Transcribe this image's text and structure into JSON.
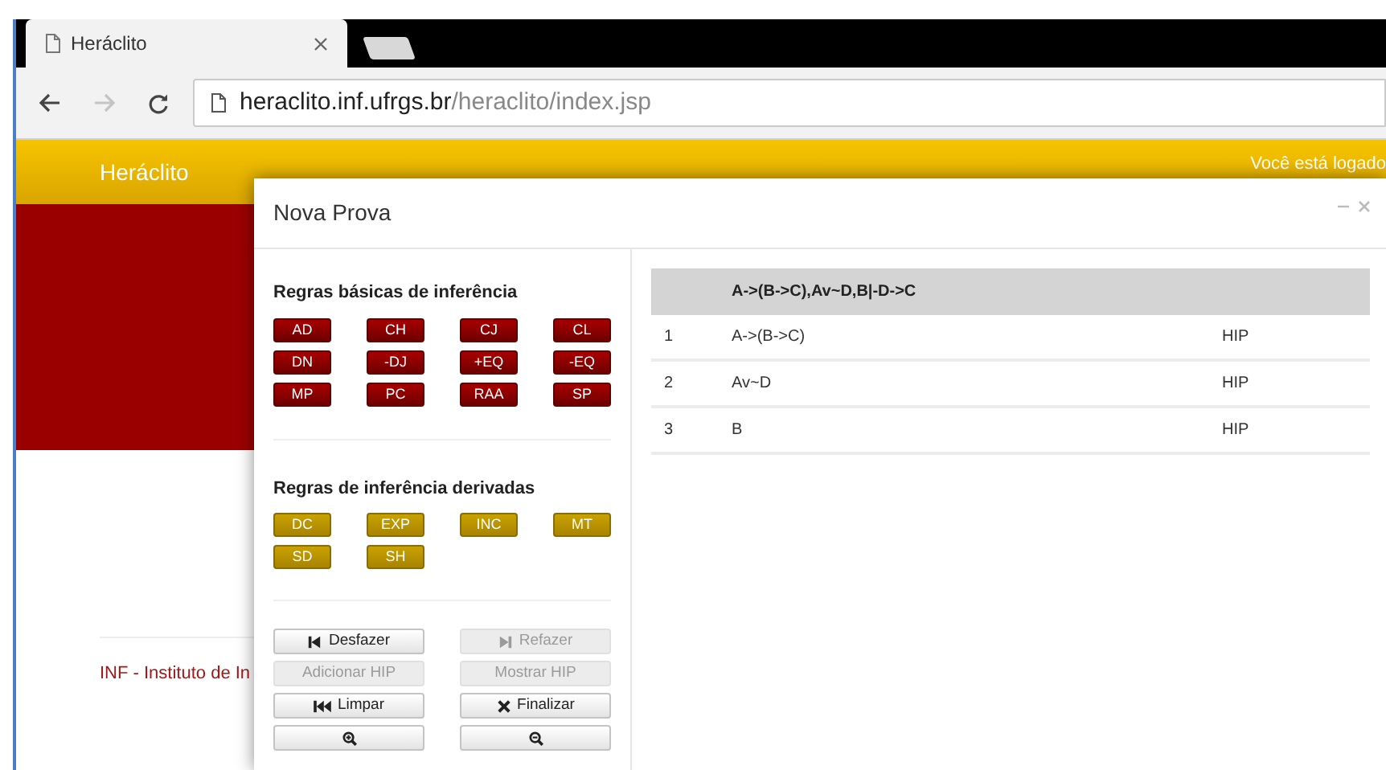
{
  "browser": {
    "tab": {
      "title": "Heráclito",
      "selected": true
    },
    "back_disabled": false,
    "forward_disabled": true,
    "url": {
      "host": "heraclito.inf.ufrgs.br",
      "path": "/heraclito/index.jsp"
    }
  },
  "page": {
    "brand": "Heráclito",
    "login_text": "Você está logado",
    "footer": "INF - Instituto de In"
  },
  "dialog": {
    "title": "Nova Prova",
    "basic_rules": {
      "heading": "Regras básicas de inferência",
      "items": [
        "AD",
        "CH",
        "CJ",
        "CL",
        "DN",
        "-DJ",
        "+EQ",
        "-EQ",
        "MP",
        "PC",
        "RAA",
        "SP"
      ]
    },
    "derived_rules": {
      "heading": "Regras de inferência derivadas",
      "items": [
        "DC",
        "EXP",
        "INC",
        "MT",
        "SD",
        "SH"
      ]
    },
    "actions": [
      {
        "kind": "undo",
        "label": "Desfazer",
        "disabled": false
      },
      {
        "kind": "redo",
        "label": "Refazer",
        "disabled": true
      },
      {
        "kind": "plain",
        "label": "Adicionar HIP",
        "disabled": true
      },
      {
        "kind": "plain",
        "label": "Mostrar HIP",
        "disabled": true
      },
      {
        "kind": "clear",
        "label": "Limpar",
        "disabled": false
      },
      {
        "kind": "finish",
        "label": "Finalizar",
        "disabled": false
      },
      {
        "kind": "zoom-in",
        "disabled": false
      },
      {
        "kind": "zoom-out",
        "disabled": false
      }
    ],
    "proof": {
      "header": "A->(B->C),Av~D,B|-D->C",
      "rows": [
        {
          "column_1": "1",
          "formula": "A->(B->C)",
          "column_3": "HIP"
        },
        {
          "column_1": "2",
          "formula": "Av~D",
          "column_3": "HIP"
        },
        {
          "column_1": "3",
          "formula": "B",
          "column_3": "HIP"
        }
      ]
    }
  }
}
